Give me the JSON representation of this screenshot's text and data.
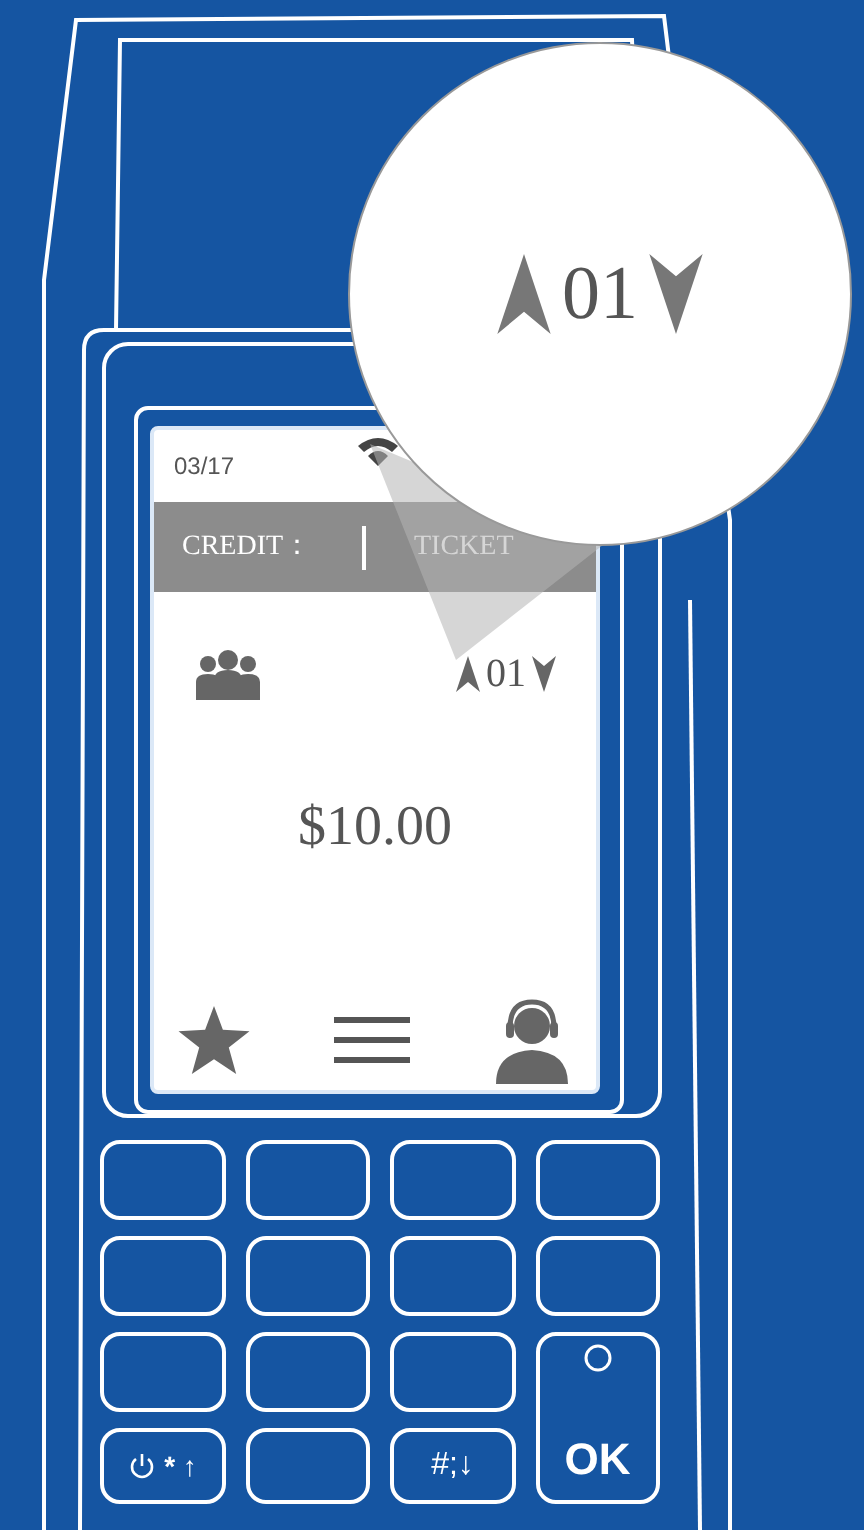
{
  "screen": {
    "date": "03/17",
    "header": {
      "credit_label": "CREDIT：",
      "ticket_label": "TICKET"
    },
    "counter": "01",
    "amount": "$10.00"
  },
  "magnifier": {
    "counter": "01"
  },
  "keypad": {
    "power_key": "* ↑",
    "hash_key": "#;↓",
    "ok_key": "OK"
  }
}
